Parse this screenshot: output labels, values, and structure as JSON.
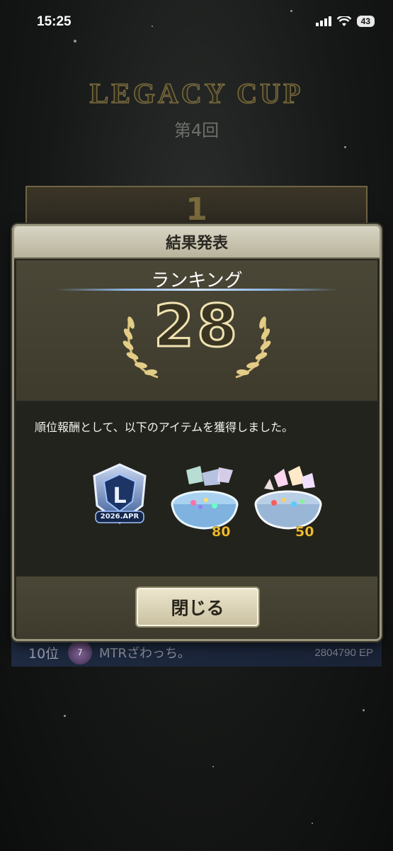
{
  "status_bar": {
    "time": "15:25",
    "battery": "43"
  },
  "background": {
    "title": "LEGACY CUP",
    "subtitle": "第4回",
    "frame_rank": "1",
    "row": {
      "rank": "10位",
      "badge": "7",
      "name": "MTRざわっち。",
      "ep": "2804790 EP"
    }
  },
  "modal": {
    "title": "結果発表",
    "ranking_label": "ランキング",
    "rank": "28",
    "reward_message": "順位報酬として、以下のアイテムを獲得しました。",
    "items": [
      {
        "icon": "legacy-cup-badge-icon",
        "label": "2026.APR",
        "count": ""
      },
      {
        "icon": "crystal-bowl-blue-icon",
        "count": "80"
      },
      {
        "icon": "crystal-bowl-rainbow-icon",
        "count": "50"
      }
    ],
    "close_label": "閉じる"
  },
  "colors": {
    "gold": "#f0e2b0",
    "accent_count": "#f1c232",
    "panel": "#3e3b2d",
    "header": "#c8c3ad"
  }
}
